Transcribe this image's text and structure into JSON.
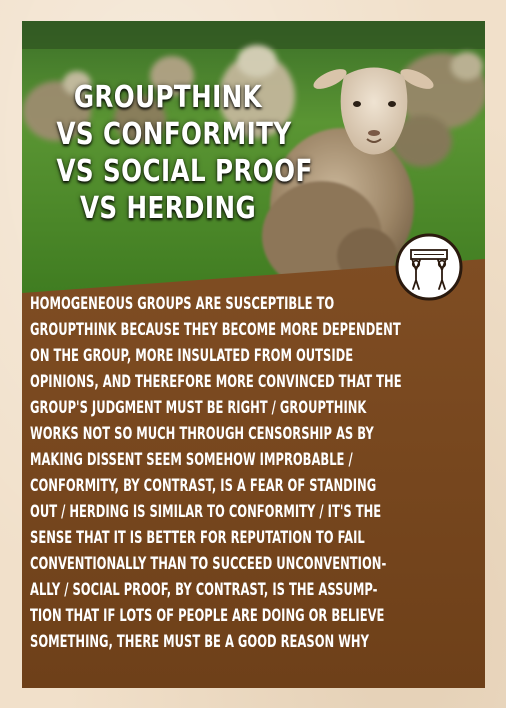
{
  "poster": {
    "title_lines": [
      "GROUPTHINK",
      "VS CONFORMITY",
      "VS SOCIAL PROOF",
      "VS HERDING"
    ],
    "body_lines": [
      "HOMOGENEOUS GROUPS ARE SUSCEPTIBLE TO",
      "GROUPTHINK BECAUSE THEY BECOME MORE DEPENDENT",
      "ON THE GROUP, MORE INSULATED FROM OUTSIDE",
      "OPINIONS, AND THEREFORE MORE CONVINCED THAT THE",
      "GROUP'S JUDGMENT MUST BE RIGHT / GROUPTHINK",
      "WORKS NOT SO MUCH THROUGH CENSORSHIP AS BY",
      "MAKING DISSENT SEEM SOMEHOW IMPROBABLE /",
      "CONFORMITY, BY CONTRAST, IS A FEAR OF STANDING",
      "OUT / HERDING IS SIMILAR TO CONFORMITY / IT'S THE",
      "SENSE THAT IT IS BETTER FOR REPUTATION TO FAIL",
      "CONVENTIONALLY THAN TO SUCCEED UNCONVENTION-",
      "ALLY / SOCIAL PROOF, BY CONTRAST, IS THE ASSUMP-",
      "TION THAT IF LOTS OF PEOPLE ARE DOING OR BELIEVE",
      "SOMETHING, THERE MUST BE A GOOD REASON WHY"
    ],
    "colors": {
      "page_background": "#f1e0ca",
      "panel_brown": "#7a4a22",
      "text": "#ffffff",
      "grass": "#4f8a2c"
    },
    "icons": {
      "photo": "sheep-photo",
      "badge": "two-people-holding-sign-icon"
    }
  }
}
